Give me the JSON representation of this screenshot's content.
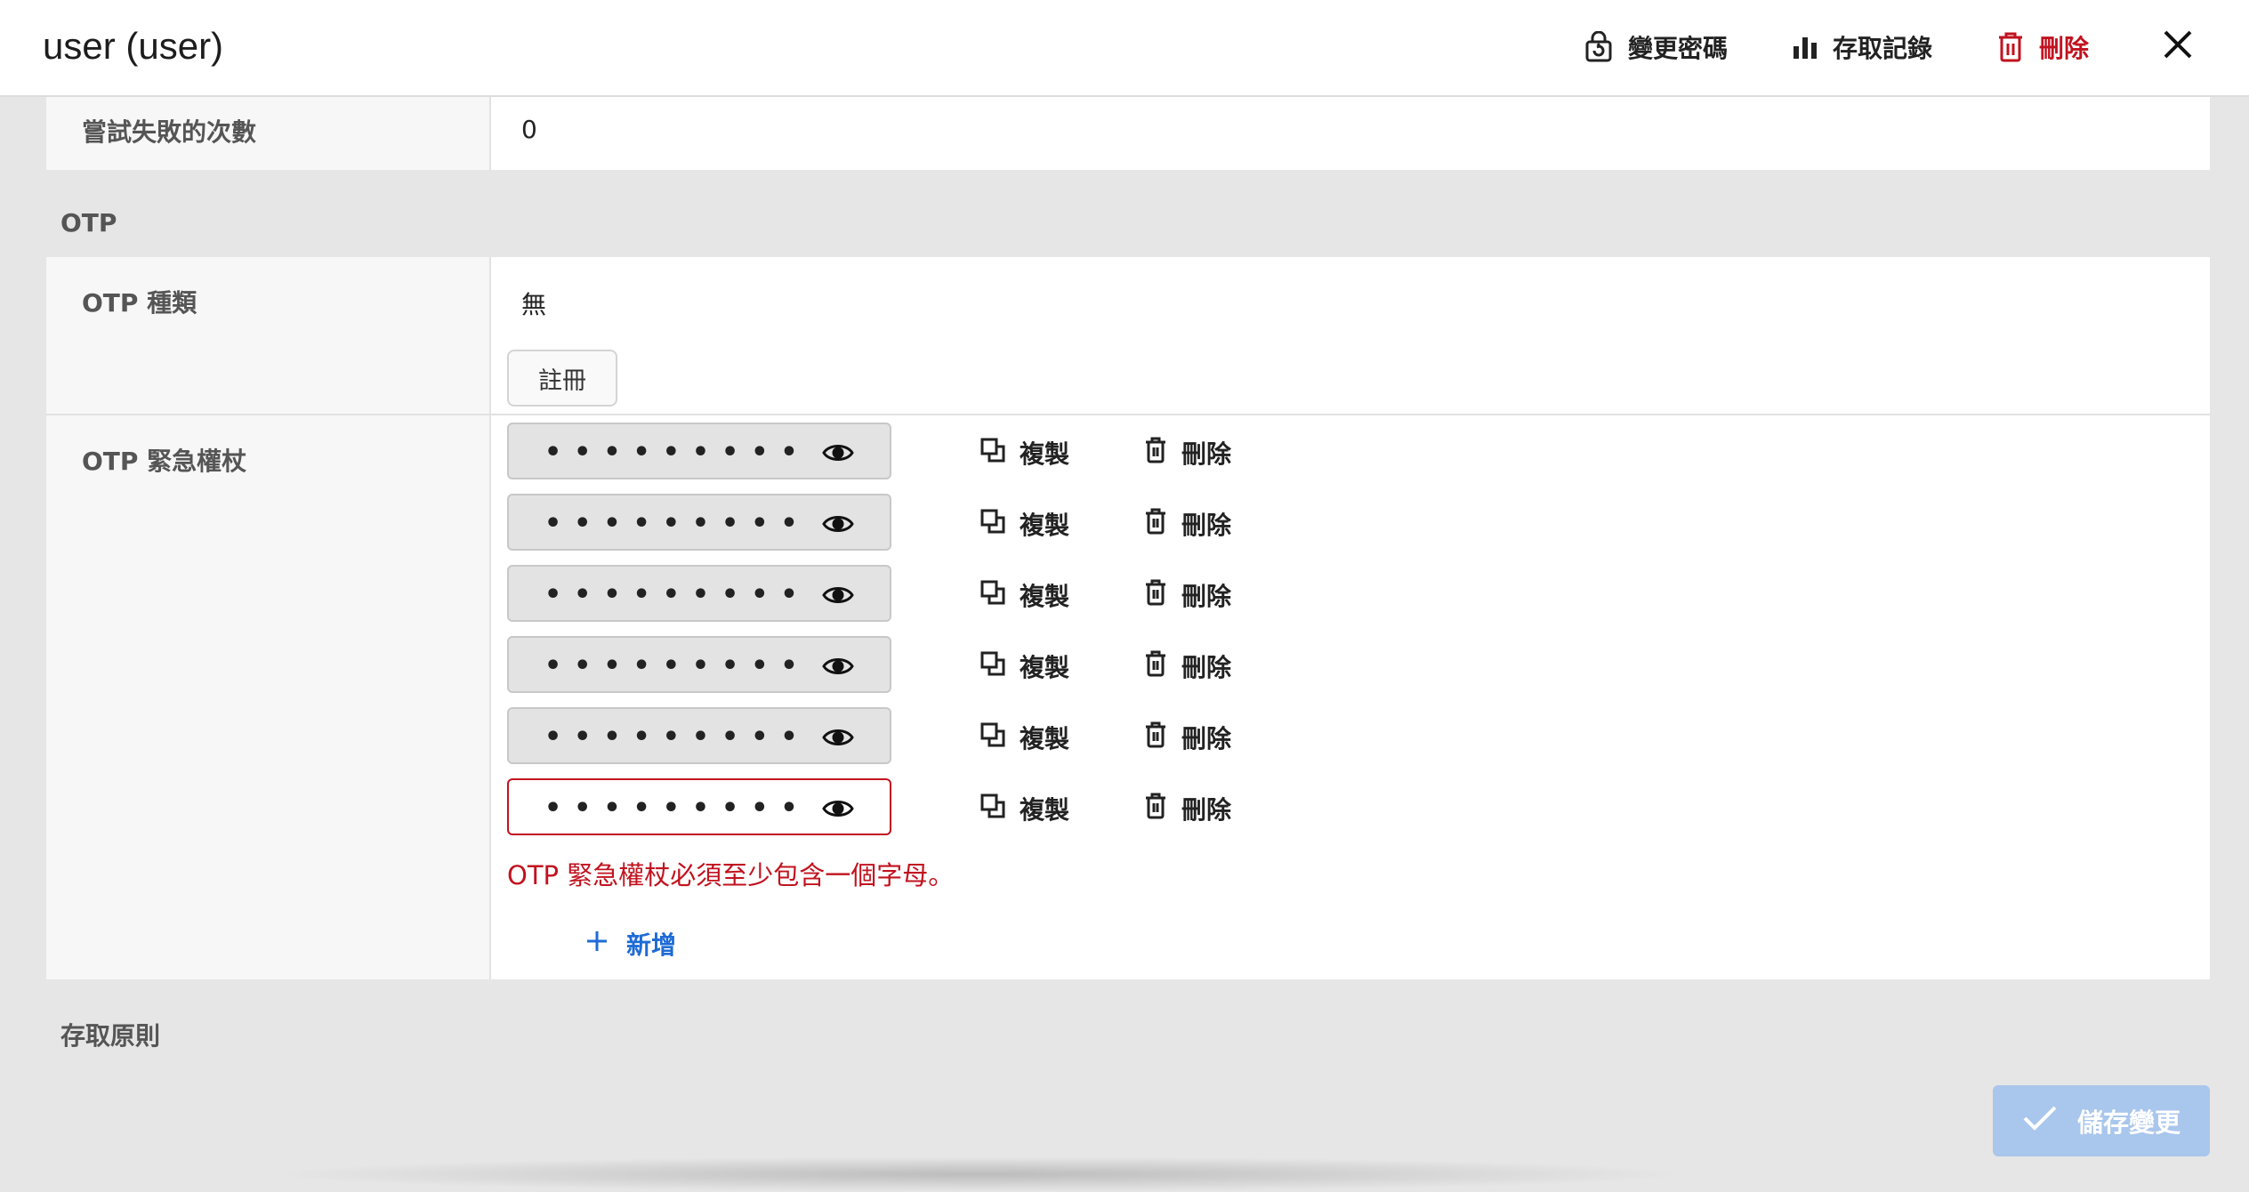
{
  "header": {
    "title": "user (user)",
    "change_password": "變更密碼",
    "access_log": "存取記錄",
    "delete": "刪除"
  },
  "failed_attempts": {
    "label": "嘗試失敗的次數",
    "value": "0"
  },
  "otp_section": {
    "title": "OTP",
    "type_label": "OTP 種類",
    "type_value": "無",
    "register_button": "註冊",
    "emergency_label": "OTP 緊急權杖",
    "tokens": [
      {
        "dots": "•••••••••",
        "error": false
      },
      {
        "dots": "•••••••••",
        "error": false
      },
      {
        "dots": "•••••••••",
        "error": false
      },
      {
        "dots": "•••••••••",
        "error": false
      },
      {
        "dots": "•••••••••",
        "error": false
      },
      {
        "dots": "•••••••••",
        "error": true
      }
    ],
    "copy_label": "複製",
    "delete_label": "刪除",
    "error_message": "OTP 緊急權杖必須至少包含一個字母。",
    "add_label": "新增"
  },
  "access_policy": {
    "title": "存取原則"
  },
  "footer": {
    "save_label": "儲存變更"
  },
  "colors": {
    "danger": "#c1121f",
    "accent": "#1e6bd6",
    "save_disabled": "#a9c6ec"
  }
}
